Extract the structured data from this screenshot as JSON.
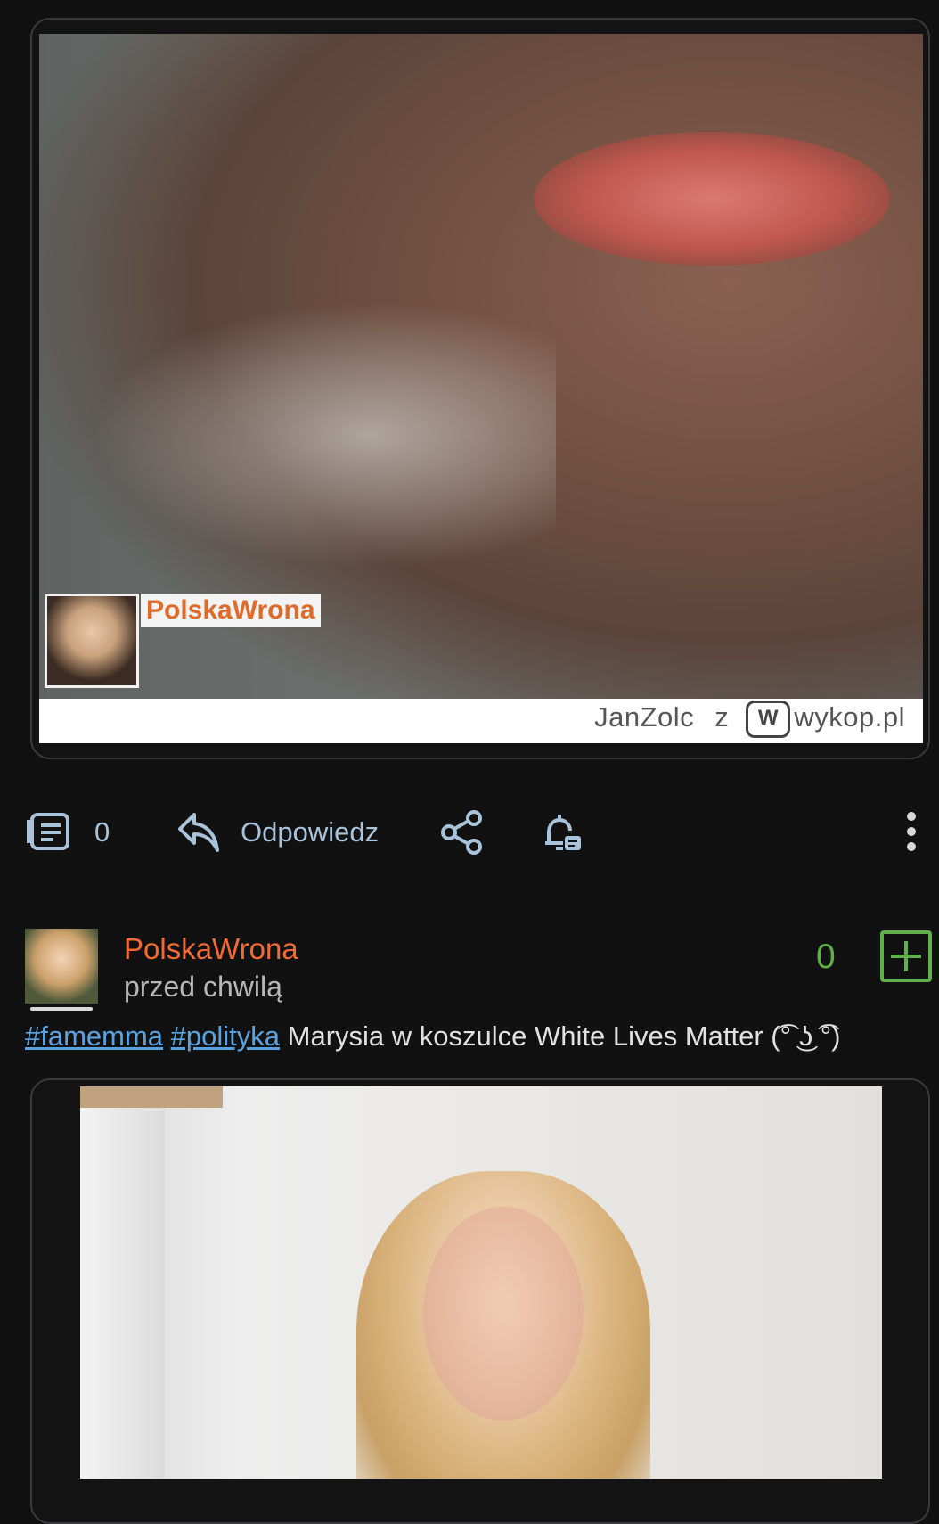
{
  "post1": {
    "image": {
      "watermark_user": "PolskaWrona",
      "footer_author": "JanZolc",
      "footer_separator": "z",
      "footer_site": "wykop.pl",
      "footer_badge": "W"
    },
    "actions": {
      "comment_count": "0",
      "reply_label": "Odpowiedz",
      "icons": [
        "comment-icon",
        "reply-icon",
        "share-icon",
        "notification-bell-icon",
        "more-vertical-icon"
      ]
    }
  },
  "comment": {
    "username": "PolskaWrona",
    "timestamp": "przed chwilą",
    "vote_count": "0",
    "tags": [
      "#famemma",
      "#polityka"
    ],
    "text": "Marysia w koszulce White Lives Matter (͡° ͜ʖ ͡°)"
  },
  "colors": {
    "background": "#111112",
    "username": "#f26b32",
    "link": "#5aa3e0",
    "vote": "#5fb04a",
    "action": "#a9c3da"
  }
}
